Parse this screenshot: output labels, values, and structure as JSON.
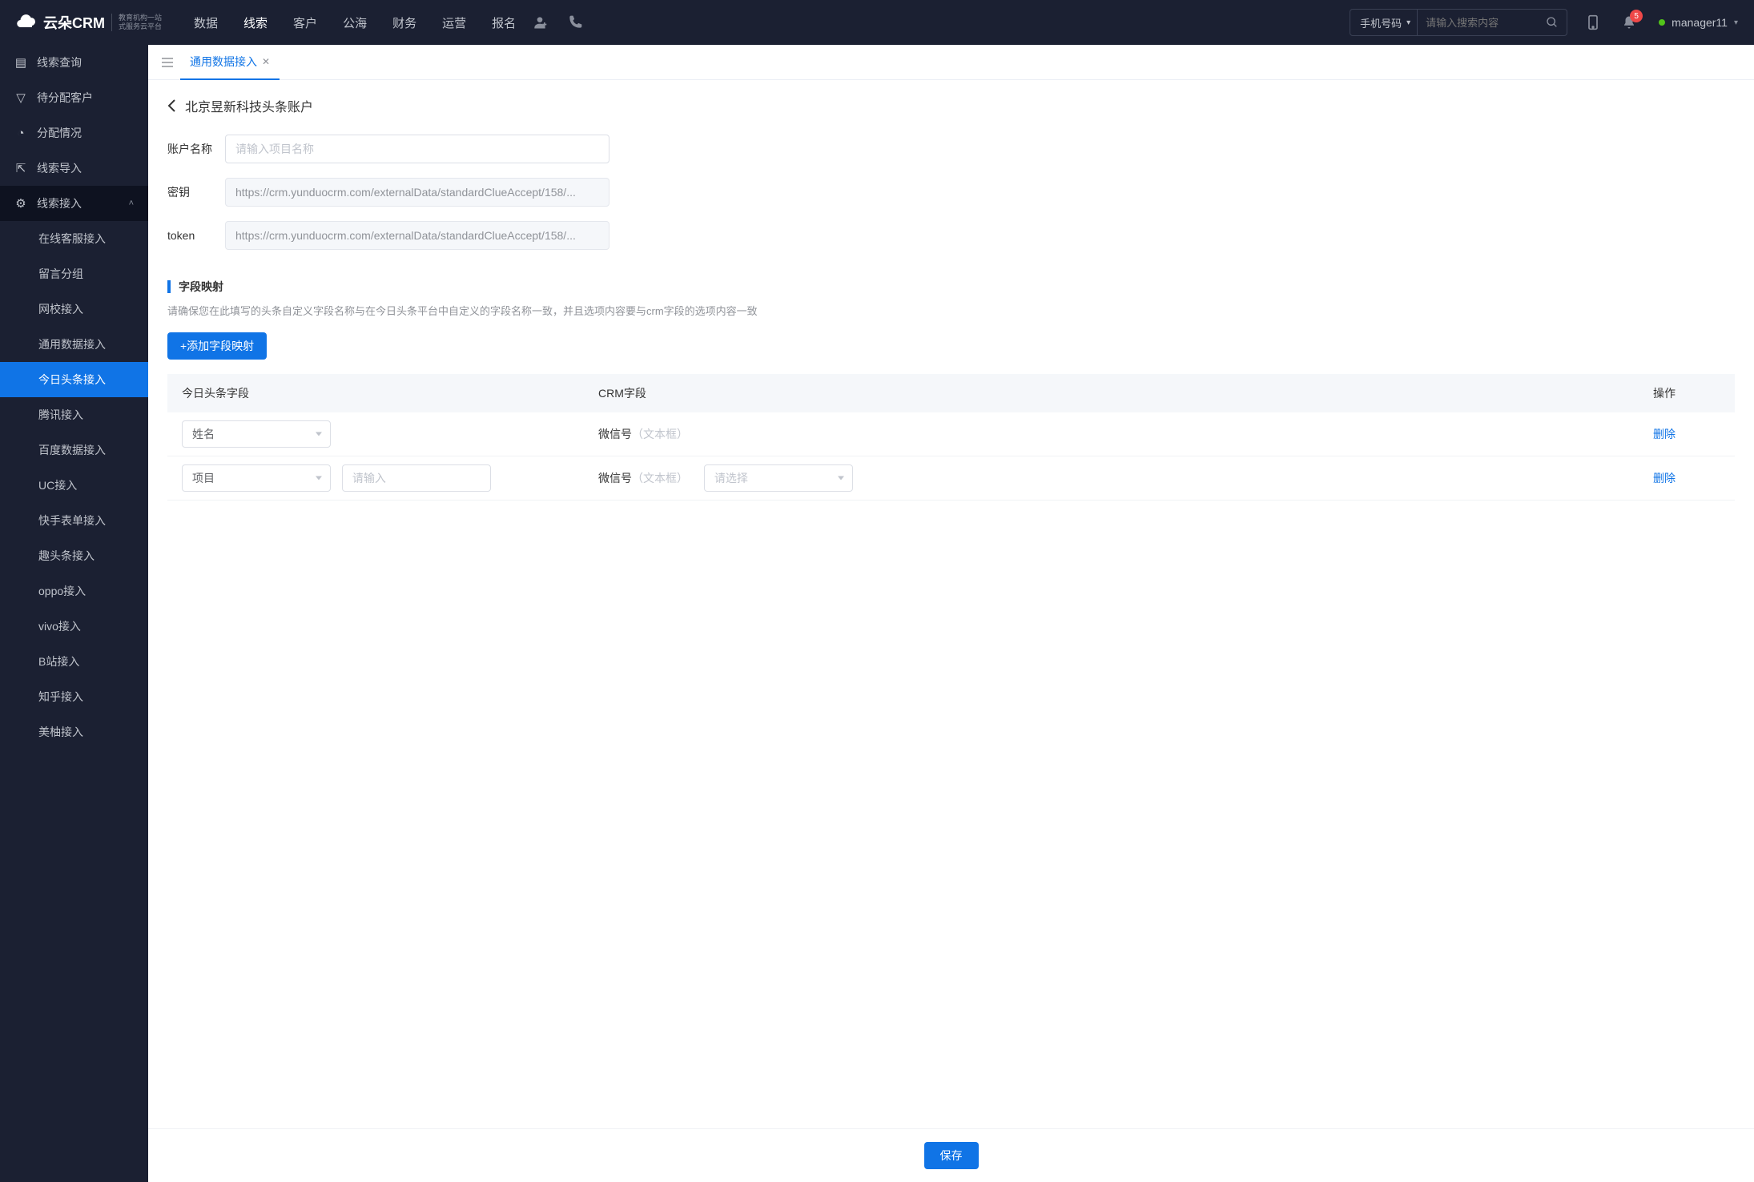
{
  "header": {
    "logo_main": "云朵CRM",
    "logo_sub1": "教育机构一站",
    "logo_sub2": "式服务云平台",
    "nav": [
      "数据",
      "线索",
      "客户",
      "公海",
      "财务",
      "运营",
      "报名"
    ],
    "nav_active": "线索",
    "search_type": "手机号码",
    "search_placeholder": "请输入搜索内容",
    "badge": "5",
    "user": "manager11"
  },
  "sidebar": {
    "items": [
      {
        "label": "线索查询"
      },
      {
        "label": "待分配客户"
      },
      {
        "label": "分配情况"
      },
      {
        "label": "线索导入"
      },
      {
        "label": "线索接入",
        "expanded": true,
        "children": [
          {
            "label": "在线客服接入"
          },
          {
            "label": "留言分组"
          },
          {
            "label": "网校接入"
          },
          {
            "label": "通用数据接入"
          },
          {
            "label": "今日头条接入",
            "active": true
          },
          {
            "label": "腾讯接入"
          },
          {
            "label": "百度数据接入"
          },
          {
            "label": "UC接入"
          },
          {
            "label": "快手表单接入"
          },
          {
            "label": "趣头条接入"
          },
          {
            "label": "oppo接入"
          },
          {
            "label": "vivo接入"
          },
          {
            "label": "B站接入"
          },
          {
            "label": "知乎接入"
          },
          {
            "label": "美柚接入"
          }
        ]
      }
    ]
  },
  "tabs": {
    "active": "通用数据接入"
  },
  "page": {
    "title": "北京昱新科技头条账户",
    "form": {
      "account_label": "账户名称",
      "account_placeholder": "请输入项目名称",
      "secret_label": "密钥",
      "secret_value": "https://crm.yunduocrm.com/externalData/standardClueAccept/158/...",
      "token_label": "token",
      "token_value": "https://crm.yunduocrm.com/externalData/standardClueAccept/158/..."
    },
    "mapping": {
      "title": "字段映射",
      "desc": "请确保您在此填写的头条自定义字段名称与在今日头条平台中自定义的字段名称一致，并且选项内容要与crm字段的选项内容一致",
      "add_btn": "+添加字段映射",
      "columns": {
        "c1": "今日头条字段",
        "c2": "CRM字段",
        "c3": "操作"
      },
      "rows": [
        {
          "toutiao_select": "姓名",
          "toutiao_input": null,
          "crm_label": "微信号",
          "crm_hint": "（文本框）",
          "crm_select": null,
          "delete": "删除"
        },
        {
          "toutiao_select": "项目",
          "toutiao_input_placeholder": "请输入",
          "crm_label": "微信号",
          "crm_hint": "（文本框）",
          "crm_select_placeholder": "请选择",
          "delete": "删除"
        }
      ]
    },
    "save": "保存"
  }
}
